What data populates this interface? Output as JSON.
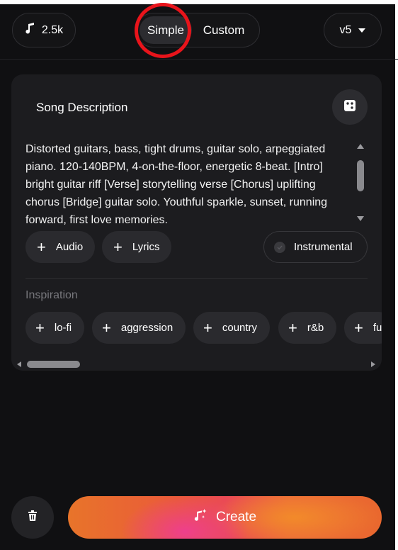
{
  "header": {
    "credits": "2.5k",
    "credits_icon": "music-note-icon",
    "mode_simple": "Simple",
    "mode_custom": "Custom",
    "version": "v5"
  },
  "card": {
    "title": "Song Description",
    "dice_icon": "dice-icon",
    "description": "Distorted guitars, bass, tight drums, guitar solo, arpeggiated piano. 120-140BPM, 4-on-the-floor, energetic 8-beat. [Intro] bright guitar riff [Verse] storytelling verse [Chorus] uplifting chorus [Bridge] guitar solo. Youthful sparkle, sunset, running forward, first love memories.",
    "audio_label": "Audio",
    "lyrics_label": "Lyrics",
    "instrumental_label": "Instrumental",
    "inspiration_label": "Inspiration",
    "tags": [
      "lo-fi",
      "aggression",
      "country",
      "r&b",
      "fu"
    ]
  },
  "footer": {
    "trash_icon": "trash-icon",
    "create_label": "Create",
    "create_icon": "music-sparkle-icon"
  },
  "colors": {
    "background": "#101012",
    "card": "#1c1c1f",
    "highlight_ring": "#e8141b",
    "create_gradient_start": "#e8742a",
    "create_gradient_mid": "#ee3f8c"
  }
}
